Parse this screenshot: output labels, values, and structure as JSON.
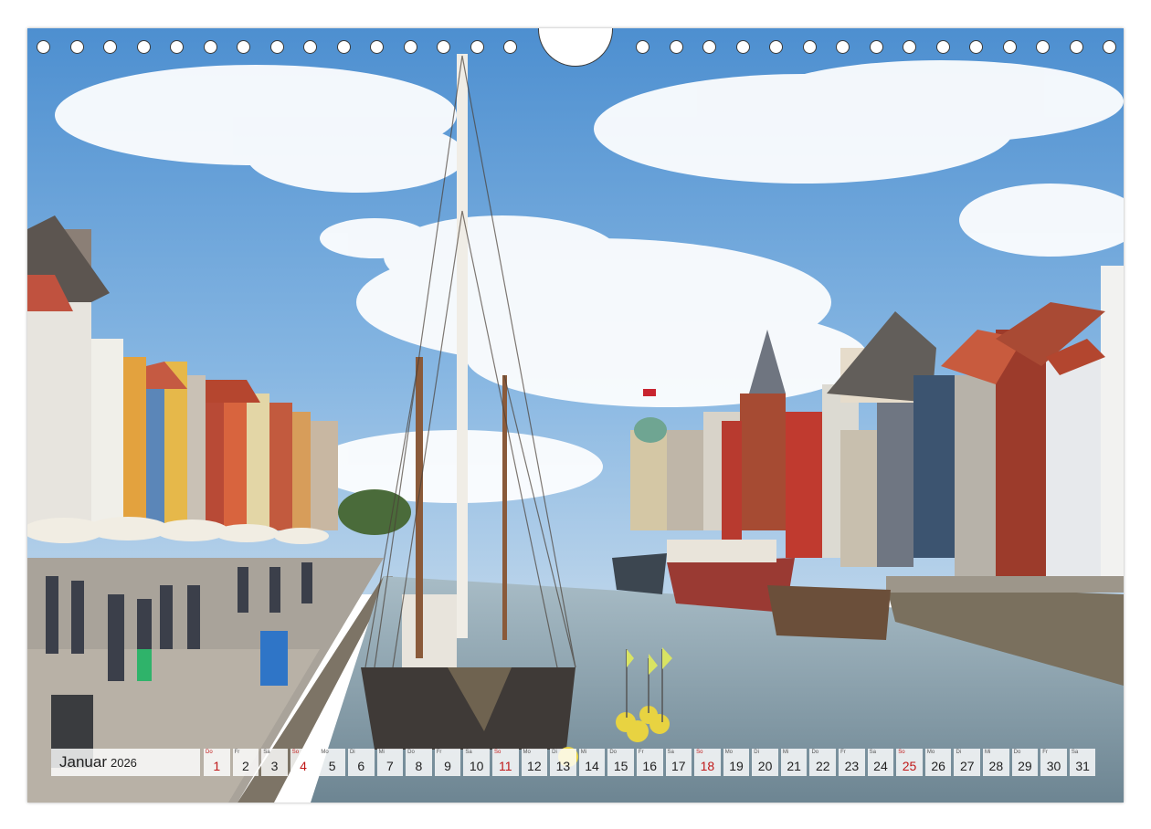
{
  "calendar": {
    "month": "Januar",
    "year": "2026",
    "photo_description": "Nyhavn",
    "days": [
      {
        "wd": "Do",
        "num": "1",
        "red": true
      },
      {
        "wd": "Fr",
        "num": "2",
        "red": false
      },
      {
        "wd": "Sa",
        "num": "3",
        "red": false
      },
      {
        "wd": "So",
        "num": "4",
        "red": true
      },
      {
        "wd": "Mo",
        "num": "5",
        "red": false
      },
      {
        "wd": "Di",
        "num": "6",
        "red": false
      },
      {
        "wd": "Mi",
        "num": "7",
        "red": false
      },
      {
        "wd": "Do",
        "num": "8",
        "red": false
      },
      {
        "wd": "Fr",
        "num": "9",
        "red": false
      },
      {
        "wd": "Sa",
        "num": "10",
        "red": false
      },
      {
        "wd": "So",
        "num": "11",
        "red": true
      },
      {
        "wd": "Mo",
        "num": "12",
        "red": false
      },
      {
        "wd": "Di",
        "num": "13",
        "red": false
      },
      {
        "wd": "Mi",
        "num": "14",
        "red": false
      },
      {
        "wd": "Do",
        "num": "15",
        "red": false
      },
      {
        "wd": "Fr",
        "num": "16",
        "red": false
      },
      {
        "wd": "Sa",
        "num": "17",
        "red": false
      },
      {
        "wd": "So",
        "num": "18",
        "red": true
      },
      {
        "wd": "Mo",
        "num": "19",
        "red": false
      },
      {
        "wd": "Di",
        "num": "20",
        "red": false
      },
      {
        "wd": "Mi",
        "num": "21",
        "red": false
      },
      {
        "wd": "Do",
        "num": "22",
        "red": false
      },
      {
        "wd": "Fr",
        "num": "23",
        "red": false
      },
      {
        "wd": "Sa",
        "num": "24",
        "red": false
      },
      {
        "wd": "So",
        "num": "25",
        "red": true
      },
      {
        "wd": "Mo",
        "num": "26",
        "red": false
      },
      {
        "wd": "Di",
        "num": "27",
        "red": false
      },
      {
        "wd": "Mi",
        "num": "28",
        "red": false
      },
      {
        "wd": "Do",
        "num": "29",
        "red": false
      },
      {
        "wd": "Fr",
        "num": "30",
        "red": false
      },
      {
        "wd": "Sa",
        "num": "31",
        "red": false
      }
    ]
  },
  "colors": {
    "sunday_red": "#c01818",
    "sky_blue": "#5f9fd6",
    "water": "#8fa7b4"
  },
  "icons": [
    "ring-binding-hole-icon",
    "hanger-cutout-icon"
  ]
}
